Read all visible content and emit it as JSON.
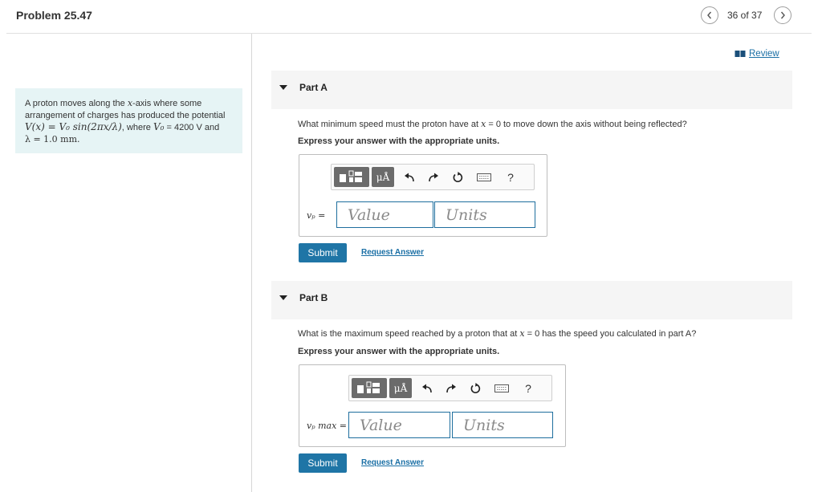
{
  "header": {
    "title": "Problem 25.47",
    "nav_count": "36 of 37"
  },
  "review_label": "Review",
  "problem": {
    "line1": "A proton moves along the ",
    "line1_var": "x",
    "line1_rest": "-axis where some",
    "line2": "arrangement of charges has produced the potential",
    "formula": "V(x) = V₀ sin(2πx/λ)",
    "where_text": ", where ",
    "v0": "V₀",
    "v0_value": " = 4200 V and",
    "lambda_line": "λ = 1.0 mm."
  },
  "toolbar": {
    "units_symbol": "μÅ",
    "help": "?"
  },
  "parts": [
    {
      "label": "Part A",
      "question_pre": "What minimum speed must the proton have at ",
      "question_var": "x",
      "question_post": " = 0 to move down the axis without being reflected?",
      "instruction": "Express your answer with the appropriate units.",
      "var_label": "vₚ =",
      "value_placeholder": "Value",
      "units_placeholder": "Units",
      "submit": "Submit",
      "request": "Request Answer"
    },
    {
      "label": "Part B",
      "question_pre": "What is the maximum speed reached by a proton that at ",
      "question_var": "x",
      "question_post": " = 0 has the speed you calculated in part A?",
      "instruction": "Express your answer with the appropriate units.",
      "var_label": "vₚ max =",
      "value_placeholder": "Value",
      "units_placeholder": "Units",
      "submit": "Submit",
      "request": "Request Answer"
    }
  ]
}
